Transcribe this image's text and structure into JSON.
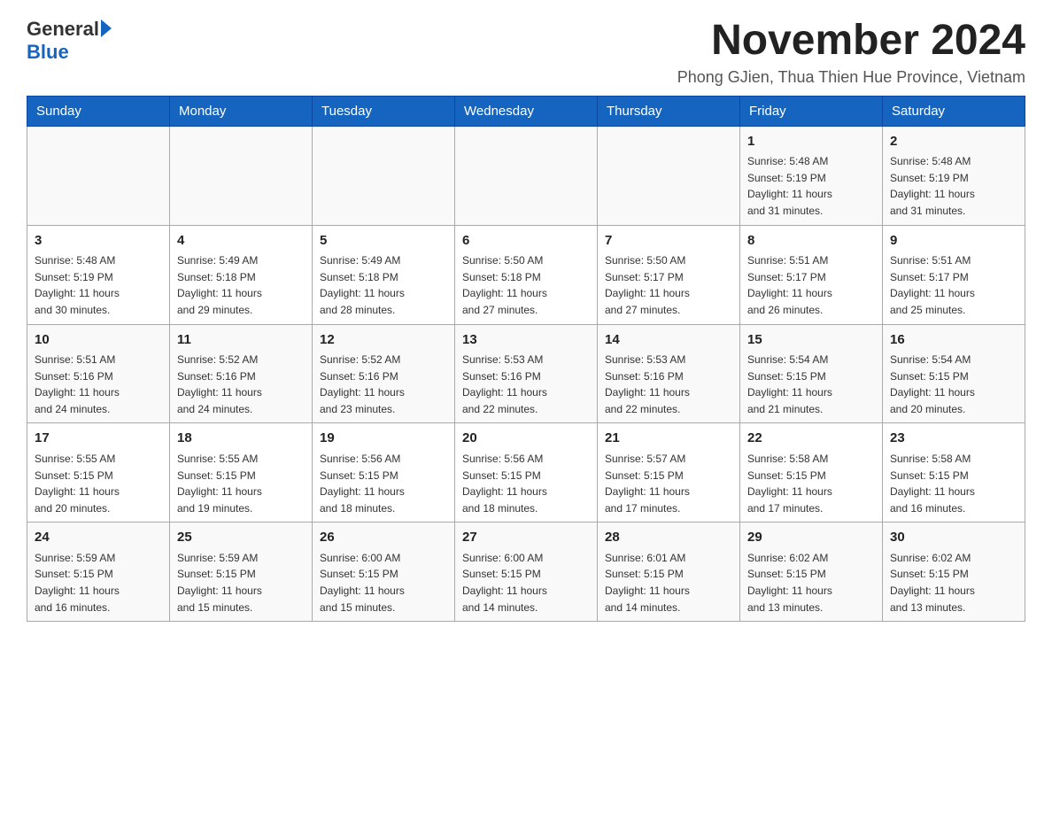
{
  "header": {
    "logo_general": "General",
    "logo_blue": "Blue",
    "title": "November 2024",
    "location": "Phong GJien, Thua Thien Hue Province, Vietnam"
  },
  "weekdays": [
    "Sunday",
    "Monday",
    "Tuesday",
    "Wednesday",
    "Thursday",
    "Friday",
    "Saturday"
  ],
  "weeks": [
    [
      {
        "day": "",
        "info": ""
      },
      {
        "day": "",
        "info": ""
      },
      {
        "day": "",
        "info": ""
      },
      {
        "day": "",
        "info": ""
      },
      {
        "day": "",
        "info": ""
      },
      {
        "day": "1",
        "info": "Sunrise: 5:48 AM\nSunset: 5:19 PM\nDaylight: 11 hours\nand 31 minutes."
      },
      {
        "day": "2",
        "info": "Sunrise: 5:48 AM\nSunset: 5:19 PM\nDaylight: 11 hours\nand 31 minutes."
      }
    ],
    [
      {
        "day": "3",
        "info": "Sunrise: 5:48 AM\nSunset: 5:19 PM\nDaylight: 11 hours\nand 30 minutes."
      },
      {
        "day": "4",
        "info": "Sunrise: 5:49 AM\nSunset: 5:18 PM\nDaylight: 11 hours\nand 29 minutes."
      },
      {
        "day": "5",
        "info": "Sunrise: 5:49 AM\nSunset: 5:18 PM\nDaylight: 11 hours\nand 28 minutes."
      },
      {
        "day": "6",
        "info": "Sunrise: 5:50 AM\nSunset: 5:18 PM\nDaylight: 11 hours\nand 27 minutes."
      },
      {
        "day": "7",
        "info": "Sunrise: 5:50 AM\nSunset: 5:17 PM\nDaylight: 11 hours\nand 27 minutes."
      },
      {
        "day": "8",
        "info": "Sunrise: 5:51 AM\nSunset: 5:17 PM\nDaylight: 11 hours\nand 26 minutes."
      },
      {
        "day": "9",
        "info": "Sunrise: 5:51 AM\nSunset: 5:17 PM\nDaylight: 11 hours\nand 25 minutes."
      }
    ],
    [
      {
        "day": "10",
        "info": "Sunrise: 5:51 AM\nSunset: 5:16 PM\nDaylight: 11 hours\nand 24 minutes."
      },
      {
        "day": "11",
        "info": "Sunrise: 5:52 AM\nSunset: 5:16 PM\nDaylight: 11 hours\nand 24 minutes."
      },
      {
        "day": "12",
        "info": "Sunrise: 5:52 AM\nSunset: 5:16 PM\nDaylight: 11 hours\nand 23 minutes."
      },
      {
        "day": "13",
        "info": "Sunrise: 5:53 AM\nSunset: 5:16 PM\nDaylight: 11 hours\nand 22 minutes."
      },
      {
        "day": "14",
        "info": "Sunrise: 5:53 AM\nSunset: 5:16 PM\nDaylight: 11 hours\nand 22 minutes."
      },
      {
        "day": "15",
        "info": "Sunrise: 5:54 AM\nSunset: 5:15 PM\nDaylight: 11 hours\nand 21 minutes."
      },
      {
        "day": "16",
        "info": "Sunrise: 5:54 AM\nSunset: 5:15 PM\nDaylight: 11 hours\nand 20 minutes."
      }
    ],
    [
      {
        "day": "17",
        "info": "Sunrise: 5:55 AM\nSunset: 5:15 PM\nDaylight: 11 hours\nand 20 minutes."
      },
      {
        "day": "18",
        "info": "Sunrise: 5:55 AM\nSunset: 5:15 PM\nDaylight: 11 hours\nand 19 minutes."
      },
      {
        "day": "19",
        "info": "Sunrise: 5:56 AM\nSunset: 5:15 PM\nDaylight: 11 hours\nand 18 minutes."
      },
      {
        "day": "20",
        "info": "Sunrise: 5:56 AM\nSunset: 5:15 PM\nDaylight: 11 hours\nand 18 minutes."
      },
      {
        "day": "21",
        "info": "Sunrise: 5:57 AM\nSunset: 5:15 PM\nDaylight: 11 hours\nand 17 minutes."
      },
      {
        "day": "22",
        "info": "Sunrise: 5:58 AM\nSunset: 5:15 PM\nDaylight: 11 hours\nand 17 minutes."
      },
      {
        "day": "23",
        "info": "Sunrise: 5:58 AM\nSunset: 5:15 PM\nDaylight: 11 hours\nand 16 minutes."
      }
    ],
    [
      {
        "day": "24",
        "info": "Sunrise: 5:59 AM\nSunset: 5:15 PM\nDaylight: 11 hours\nand 16 minutes."
      },
      {
        "day": "25",
        "info": "Sunrise: 5:59 AM\nSunset: 5:15 PM\nDaylight: 11 hours\nand 15 minutes."
      },
      {
        "day": "26",
        "info": "Sunrise: 6:00 AM\nSunset: 5:15 PM\nDaylight: 11 hours\nand 15 minutes."
      },
      {
        "day": "27",
        "info": "Sunrise: 6:00 AM\nSunset: 5:15 PM\nDaylight: 11 hours\nand 14 minutes."
      },
      {
        "day": "28",
        "info": "Sunrise: 6:01 AM\nSunset: 5:15 PM\nDaylight: 11 hours\nand 14 minutes."
      },
      {
        "day": "29",
        "info": "Sunrise: 6:02 AM\nSunset: 5:15 PM\nDaylight: 11 hours\nand 13 minutes."
      },
      {
        "day": "30",
        "info": "Sunrise: 6:02 AM\nSunset: 5:15 PM\nDaylight: 11 hours\nand 13 minutes."
      }
    ]
  ]
}
